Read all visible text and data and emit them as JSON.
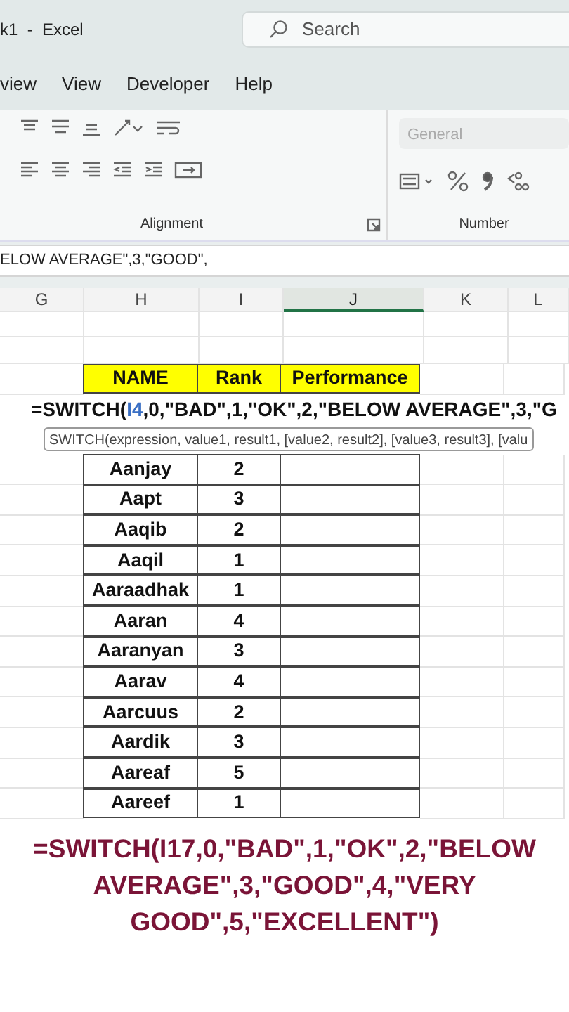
{
  "window": {
    "title": "k1  -  Excel"
  },
  "search": {
    "placeholder": "Search"
  },
  "tabs": [
    {
      "label": "view",
      "selected": false
    },
    {
      "label": "View",
      "selected": false
    },
    {
      "label": "Developer",
      "selected": false
    },
    {
      "label": "Help",
      "selected": false
    }
  ],
  "ribbon": {
    "groups": [
      {
        "label": "Alignment"
      },
      {
        "label": "Number"
      }
    ],
    "number_format": "General"
  },
  "formula_bar": {
    "value": "ELOW AVERAGE\",3,\"GOOD\","
  },
  "columns": [
    {
      "label": "G",
      "selected": false
    },
    {
      "label": "H",
      "selected": false
    },
    {
      "label": "I",
      "selected": false
    },
    {
      "label": "J",
      "selected": true
    },
    {
      "label": "K",
      "selected": false
    },
    {
      "label": "L",
      "selected": false
    }
  ],
  "table": {
    "columns": [
      "NAME",
      "Rank",
      "Performance"
    ],
    "editing": {
      "before": "=SWITCH(",
      "ref": "I4",
      "after": ",0,\"BAD\",1,\"OK\",2,\"BELOW AVERAGE\",3,\"G"
    },
    "tooltip": "SWITCH(expression, value1, result1, [value2, result2], [value3, result3], [valu",
    "rows": [
      {
        "name": "Aanjay",
        "rank": "2"
      },
      {
        "name": "Aapt",
        "rank": "3"
      },
      {
        "name": "Aaqib",
        "rank": "2"
      },
      {
        "name": "Aaqil",
        "rank": "1"
      },
      {
        "name": "Aaraadhak",
        "rank": "1"
      },
      {
        "name": "Aaran",
        "rank": "4"
      },
      {
        "name": "Aaranyan",
        "rank": "3"
      },
      {
        "name": "Aarav",
        "rank": "4"
      },
      {
        "name": "Aarcuus",
        "rank": "2"
      },
      {
        "name": "Aardik",
        "rank": "3"
      },
      {
        "name": "Aareaf",
        "rank": "5"
      },
      {
        "name": "Aareef",
        "rank": "1"
      }
    ]
  },
  "caption": "=SWITCH(I17,0,\"BAD\",1,\"OK\",2,\"BELOW AVERAGE\",3,\"GOOD\",4,\"VERY GOOD\",5,\"EXCELLENT\")"
}
